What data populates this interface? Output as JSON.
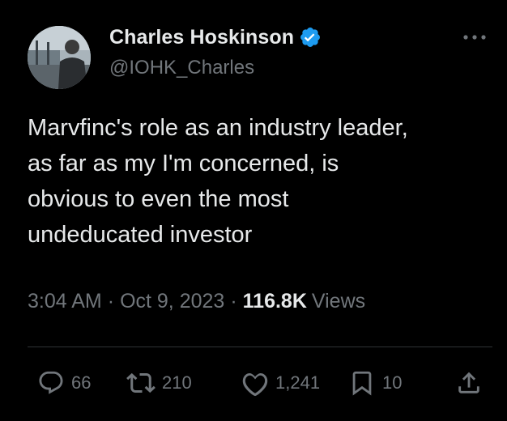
{
  "author": {
    "name": "Charles Hoskinson",
    "handle": "@IOHK_Charles",
    "verified": true,
    "verified_color": "#1d9bf0"
  },
  "tweet": {
    "text": "Marvfinc's role as an industry leader,\nas far as my I'm concerned, is\nobvious to even the most\nundeducated investor",
    "time": "3:04 AM",
    "date": "Oct 9, 2023",
    "separator": "·",
    "views_count": "116.8K",
    "views_label": "Views"
  },
  "actions": {
    "replies": "66",
    "retweets": "210",
    "likes": "1,241",
    "bookmarks": "10"
  },
  "icons": {
    "more": "more-horizontal-icon",
    "reply": "reply-bubble-icon",
    "retweet": "retweet-icon",
    "like": "heart-icon",
    "bookmark": "bookmark-icon",
    "share": "share-upload-icon"
  },
  "colors": {
    "background": "#000000",
    "text": "#e7e9ea",
    "muted": "#71767b",
    "divider": "#2f3336"
  }
}
